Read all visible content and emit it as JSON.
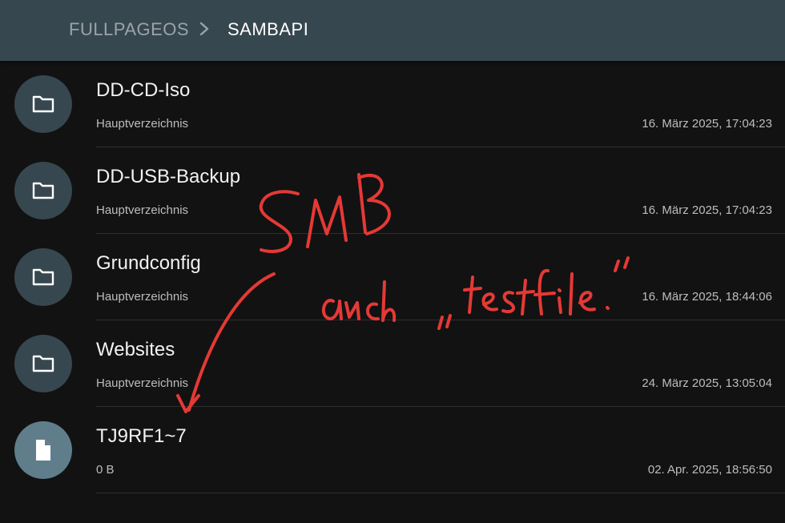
{
  "breadcrumb": {
    "root": "FULLPAGEOS",
    "current": "SAMBAPI"
  },
  "entries": [
    {
      "name": "DD-CD-Iso",
      "subtitle": "Hauptverzeichnis",
      "date": "16. März 2025, 17:04:23",
      "icon": "folder-icon"
    },
    {
      "name": "DD-USB-Backup",
      "subtitle": "Hauptverzeichnis",
      "date": "16. März 2025, 17:04:23",
      "icon": "folder-icon"
    },
    {
      "name": "Grundconfig",
      "subtitle": "Hauptverzeichnis",
      "date": "16. März 2025, 18:44:06",
      "icon": "folder-icon"
    },
    {
      "name": "Websites",
      "subtitle": "Hauptverzeichnis",
      "date": "24. März 2025, 13:05:04",
      "icon": "folder-icon"
    },
    {
      "name": "TJ9RF1~7",
      "subtitle": "0 B",
      "date": "02. Apr. 2025, 18:56:50",
      "icon": "file-icon"
    }
  ],
  "handwritten_annotation": {
    "text_1": "SMB",
    "text_2": "auch „testfile.“",
    "color": "#e53935"
  },
  "colors": {
    "header": "#37474f",
    "background": "#121212",
    "folder_circle": "#37474f",
    "file_circle": "#607d8b"
  }
}
